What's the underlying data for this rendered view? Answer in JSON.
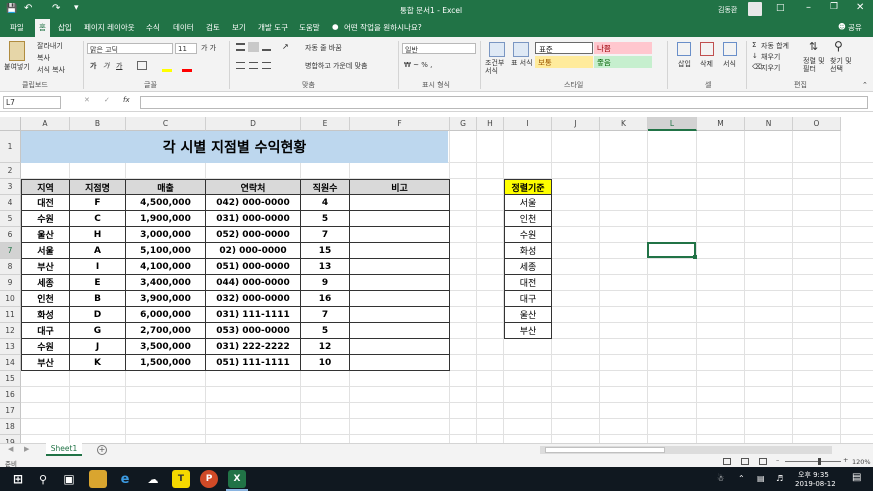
{
  "window": {
    "title": "통합 문서1 - Excel",
    "user": "김동환",
    "share_label": "공유"
  },
  "ribbon": {
    "tabs": [
      "파일",
      "홈",
      "삽입",
      "페이지 레이아웃",
      "수식",
      "데이터",
      "검토",
      "보기",
      "개발 도구",
      "도움말"
    ],
    "active_tab": "홈",
    "tell_me": "어떤 작업을 원하시나요?",
    "clipboard": {
      "paste": "붙여넣기",
      "cut": "잘라내기",
      "copy": "복사",
      "format_painter": "서식 복사",
      "label": "클립보드"
    },
    "font": {
      "name": "맑은 고딕",
      "size": "11",
      "bold": "가",
      "italic": "가",
      "underline": "가",
      "label": "글꼴"
    },
    "alignment": {
      "wrap": "자동 줄 바꿈",
      "merge": "병합하고 가운데 맞춤",
      "label": "맞춤"
    },
    "number": {
      "format": "일반",
      "label": "표시 형식"
    },
    "styles": {
      "conditional": "조건부 서식",
      "table": "표 서식",
      "normal": "표준",
      "bad": "나쁨",
      "neutral": "보통",
      "good": "좋음",
      "label": "스타일"
    },
    "cells": {
      "insert": "삽입",
      "delete": "삭제",
      "format": "서식",
      "label": "셀"
    },
    "editing": {
      "autosum": "자동 합계",
      "fill": "채우기",
      "clear": "지우기",
      "sort": "정렬 및 필터",
      "find": "찾기 및 선택",
      "label": "편집"
    }
  },
  "formula_bar": {
    "name_box": "L7",
    "fx": "fx",
    "value": ""
  },
  "columns": [
    "A",
    "B",
    "C",
    "D",
    "E",
    "F",
    "G",
    "H",
    "I",
    "J",
    "K",
    "L",
    "M",
    "N",
    "O"
  ],
  "rows": [
    "1",
    "2",
    "3",
    "4",
    "5",
    "6",
    "7",
    "8",
    "9",
    "10",
    "11",
    "12",
    "13",
    "14",
    "15",
    "16",
    "17",
    "18",
    "19"
  ],
  "selected_cell": {
    "col": "L",
    "row": "7"
  },
  "sheet": {
    "title": "각 시별 지점별 수익현황",
    "headers": [
      "지역",
      "지점명",
      "매출",
      "연락처",
      "직원수",
      "비고"
    ],
    "data": [
      [
        "대전",
        "F",
        "4,500,000",
        "042) 000-0000",
        "4",
        ""
      ],
      [
        "수원",
        "C",
        "1,900,000",
        "031) 000-0000",
        "5",
        ""
      ],
      [
        "울산",
        "H",
        "3,000,000",
        "052) 000-0000",
        "7",
        ""
      ],
      [
        "서울",
        "A",
        "5,100,000",
        "02) 000-0000",
        "15",
        ""
      ],
      [
        "부산",
        "I",
        "4,100,000",
        "051) 000-0000",
        "13",
        ""
      ],
      [
        "세종",
        "E",
        "3,400,000",
        "044) 000-0000",
        "9",
        ""
      ],
      [
        "인천",
        "B",
        "3,900,000",
        "032) 000-0000",
        "16",
        ""
      ],
      [
        "화성",
        "D",
        "6,000,000",
        "031) 111-1111",
        "7",
        ""
      ],
      [
        "대구",
        "G",
        "2,700,000",
        "053) 000-0000",
        "5",
        ""
      ],
      [
        "수원",
        "J",
        "3,500,000",
        "031) 222-2222",
        "12",
        ""
      ],
      [
        "부산",
        "K",
        "1,500,000",
        "051) 111-1111",
        "10",
        ""
      ]
    ],
    "criteria_header": "정렬기준",
    "criteria": [
      "서울",
      "인천",
      "수원",
      "화성",
      "세종",
      "대전",
      "대구",
      "울산",
      "부산"
    ]
  },
  "sheet_tabs": [
    "Sheet1"
  ],
  "status": {
    "ready": "준비",
    "zoom": "120%"
  },
  "taskbar": {
    "time": "오후 9:35",
    "date": "2019-08-12"
  },
  "colors": {
    "excel_green": "#217346",
    "title_fill": "#bdd7ee",
    "header_fill": "#d9d9d9",
    "criteria_fill": "#ffff00"
  }
}
